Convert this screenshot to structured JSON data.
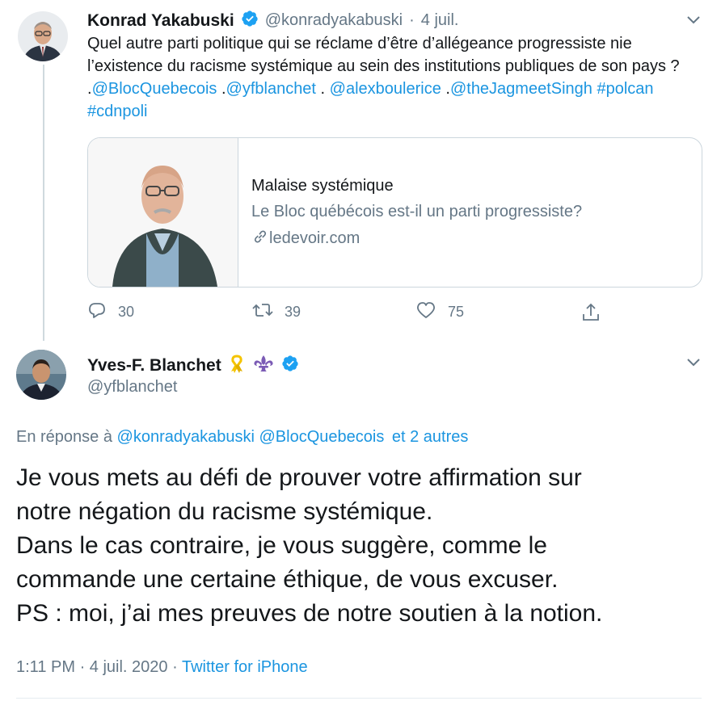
{
  "tweet1": {
    "name": "Konrad Yakabuski",
    "handle": "@konradyakabuski",
    "separator": "·",
    "date": "4 juil.",
    "text_parts": [
      {
        "t": "Quel autre parti politique qui se réclame d’être d’allégeance progressiste nie l’existence du racisme systémique au sein des institutions publiques de son pays ? .",
        "link": false
      },
      {
        "t": "@BlocQuebecois",
        "link": true
      },
      {
        "t": " .",
        "link": false
      },
      {
        "t": "@yfblanchet",
        "link": true
      },
      {
        "t": " . ",
        "link": false
      },
      {
        "t": "@alexboulerice",
        "link": true
      },
      {
        "t": " .",
        "link": false
      },
      {
        "t": "@theJagmeetSingh",
        "link": true
      },
      {
        "t": " ",
        "link": false
      },
      {
        "t": "#polcan",
        "link": true
      },
      {
        "t": " ",
        "link": false
      },
      {
        "t": "#cdnpoli",
        "link": true
      }
    ],
    "card": {
      "title": "Malaise systémique",
      "description": "Le Bloc québécois est-il un parti progressiste?",
      "domain": "ledevoir.com"
    },
    "actions": {
      "reply_count": "30",
      "retweet_count": "39",
      "like_count": "75"
    }
  },
  "tweet2": {
    "name": "Yves-F. Blanchet",
    "handle": "@yfblanchet",
    "emoji_ribbon": "🎗",
    "emoji_fleur": "⚜",
    "replying_prefix": "En réponse à",
    "replying_users": [
      "@konradyakabuski",
      "@BlocQuebecois"
    ],
    "replying_others": "et 2 autres",
    "text_lines": [
      "Je vous mets au défi de prouver votre affirmation sur",
      "notre négation du racisme systémique.",
      "Dans le cas contraire, je vous suggère, comme le",
      "commande une certaine éthique, de vous excuser.",
      "PS : moi, j’ai mes preuves de notre soutien à la notion."
    ],
    "time": "1:11 PM",
    "separator": "·",
    "date": "4 juil. 2020",
    "source": "Twitter for iPhone"
  },
  "colors": {
    "link": "#1b95e0",
    "muted": "#657786",
    "text": "#14171a",
    "verified": "#1da1f2",
    "border": "#ccd6dd",
    "ribbon": "#f5c400",
    "fleur": "#7b5bb5"
  },
  "icons": [
    "verified-badge-icon",
    "chevron-down-icon",
    "reply-icon",
    "retweet-icon",
    "like-icon",
    "share-icon",
    "link-icon",
    "ribbon-emoji-icon",
    "fleur-de-lis-emoji-icon"
  ]
}
